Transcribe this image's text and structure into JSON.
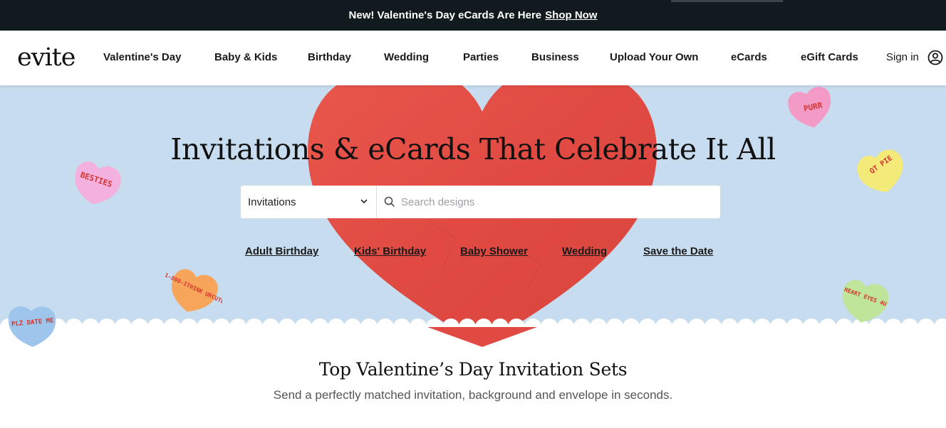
{
  "promo": {
    "text": "New! Valentine's Day eCards Are Here",
    "link": "Shop Now"
  },
  "header": {
    "logo": "evite",
    "nav": [
      "Valentine's Day",
      "Baby & Kids",
      "Birthday",
      "Wedding",
      "Parties",
      "Business",
      "Upload Your Own",
      "eCards",
      "eGift Cards"
    ],
    "signin": "Sign in",
    "user_icon": "user-circle-icon"
  },
  "hero": {
    "title": "Invitations & eCards That Celebrate It All",
    "search": {
      "category_selected": "Invitations",
      "placeholder": "Search designs"
    },
    "quick_links": [
      "Adult Birthday",
      "Kids' Birthday",
      "Baby Shower",
      "Wedding",
      "Save the Date"
    ],
    "candy_hearts": [
      {
        "text": "PURR",
        "color": "#f39ac7"
      },
      {
        "text": "BESTIES",
        "color": "#f4b0de"
      },
      {
        "text": "QT PIE",
        "color": "#f3ea7a"
      },
      {
        "text": "1-800-ITHINK URCUTE",
        "color": "#f7a55a"
      },
      {
        "text": "PLZ DATE ME",
        "color": "#9ec6ec"
      },
      {
        "text": "HEART EYES 4U",
        "color": "#bfe59a"
      }
    ],
    "colors": {
      "background": "#c7dcef",
      "heart": "#e24e45",
      "candy_text": "#d8332d"
    }
  },
  "section": {
    "title": "Top Valentine’s Day Invitation Sets",
    "subtitle": "Send a perfectly matched invitation, background and envelope in seconds."
  }
}
